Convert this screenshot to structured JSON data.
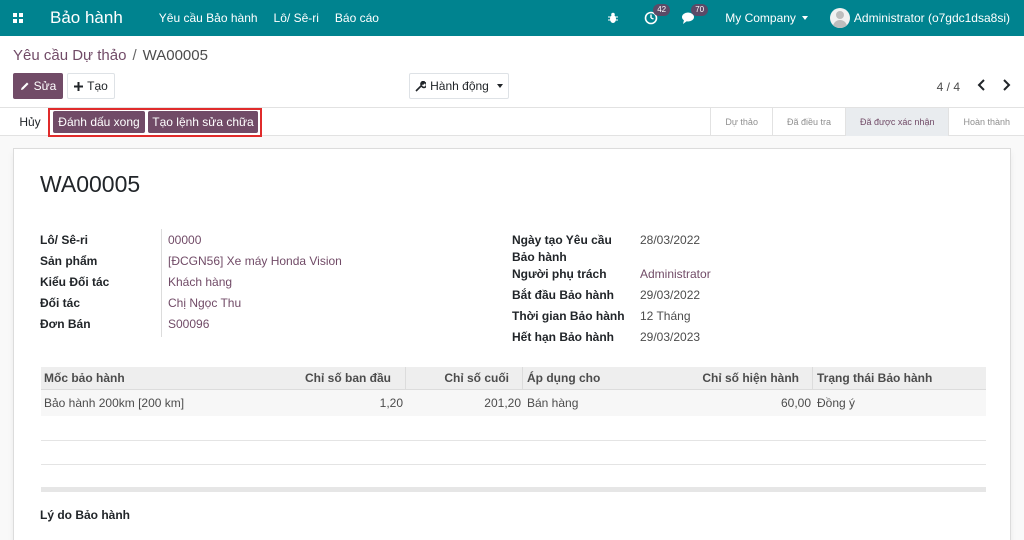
{
  "navbar": {
    "brand": "Bảo hành",
    "menu": [
      "Yêu cầu Bảo hành",
      "Lô/ Sê-ri",
      "Báo cáo"
    ],
    "activity_count": "42",
    "messages_count": "70",
    "company": "My Company",
    "user": "Administrator (o7gdc1dsa8si)"
  },
  "breadcrumb": {
    "parent": "Yêu cầu Dự thảo",
    "separator": "/",
    "current": "WA00005"
  },
  "toolbar": {
    "edit_label": "Sửa",
    "create_label": "Tạo",
    "action_label": "Hành động",
    "pager": "4 / 4"
  },
  "statusbar": {
    "cancel_label": "Hủy",
    "done_label": "Đánh dấu xong",
    "repair_label": "Tạo lệnh sửa chữa",
    "stages": [
      "Dự thảo",
      "Đã điều tra",
      "Đã được xác nhận",
      "Hoàn thành"
    ],
    "active_stage": "Đã được xác nhận"
  },
  "form": {
    "title": "WA00005",
    "left_fields": [
      {
        "label": "Lô/ Sê-ri",
        "value": "00000"
      },
      {
        "label": "Sản phẩm",
        "value": "[ĐCGN56] Xe máy Honda Vision"
      },
      {
        "label": "Kiểu Đối tác",
        "value": "Khách hàng"
      },
      {
        "label": "Đối tác",
        "value": "Chị Ngọc Thu"
      },
      {
        "label": "Đơn Bán",
        "value": "S00096"
      }
    ],
    "right_fields": [
      {
        "label": "Ngày tạo Yêu cầu Bảo hành",
        "label_line1": "Ngày tạo Yêu cầu",
        "label_line2": "Bảo hành",
        "value": "28/03/2022"
      },
      {
        "label": "Người phụ trách",
        "value": "Administrator"
      },
      {
        "label": "Bắt đầu Bảo hành",
        "value": "29/03/2022"
      },
      {
        "label": "Thời gian Bảo hành",
        "value": "12 Tháng"
      },
      {
        "label": "Hết hạn Bảo hành",
        "value": "29/03/2023"
      }
    ],
    "table": {
      "columns": [
        "Mốc bảo hành",
        "Chỉ số ban đầu",
        "Chỉ số cuối",
        "Áp dụng cho",
        "Chỉ số hiện hành",
        "Trạng thái Bảo hành"
      ],
      "rows": [
        [
          "Bảo hành 200km [200 km]",
          "1,20",
          "201,20",
          "Bán hàng",
          "60,00",
          "Đồng ý"
        ]
      ]
    },
    "reason_label": "Lý do Bảo hành"
  },
  "colors": {
    "navbar": "#00838f",
    "primary": "#714b67",
    "highlight_border": "#e02b2b"
  }
}
